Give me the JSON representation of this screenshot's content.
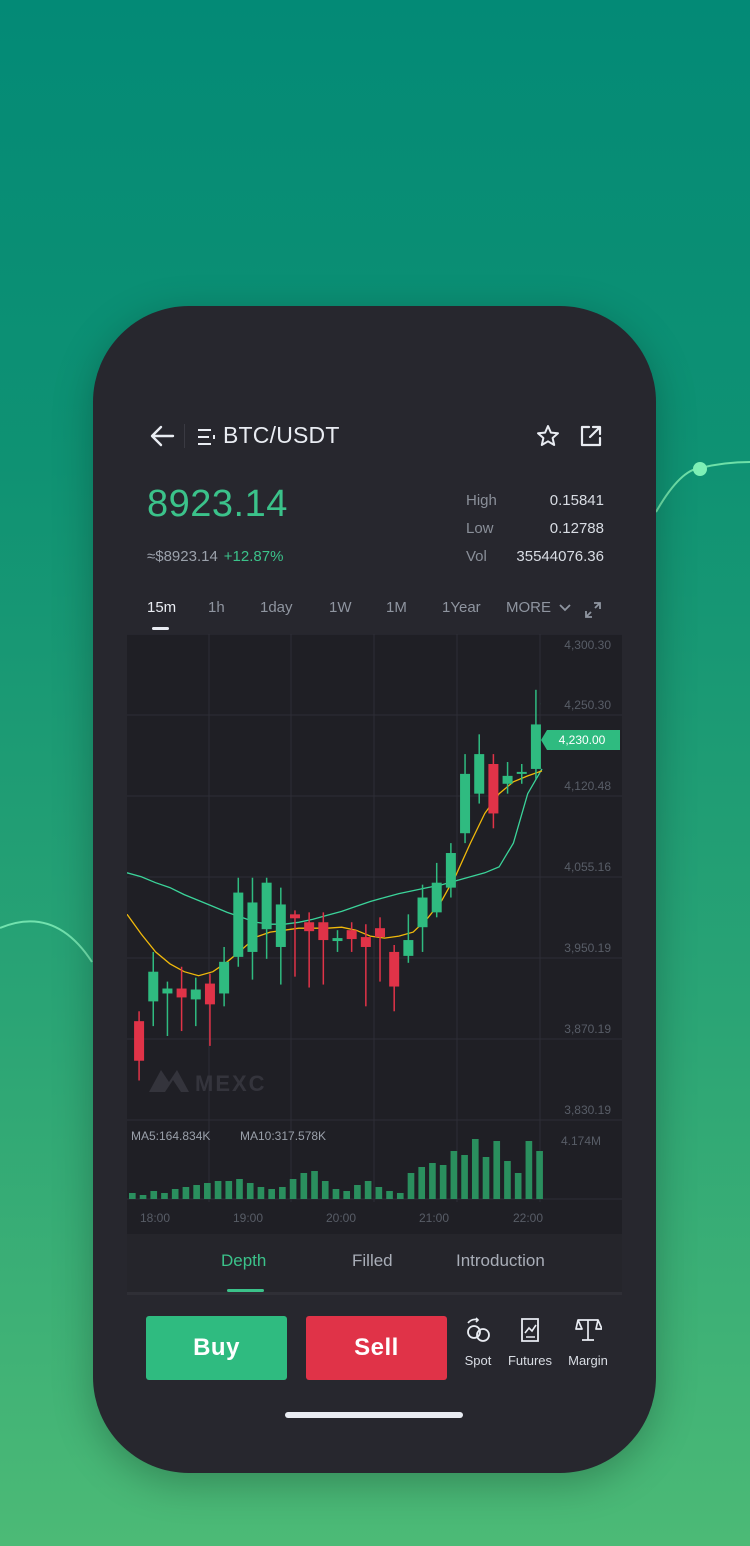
{
  "header": {
    "title": "BTC/USDT"
  },
  "ticker": {
    "price": "8923.14",
    "usd_value": "≈$8923.14",
    "change": "+12.87%",
    "stats": [
      {
        "label": "High",
        "value": "0.15841"
      },
      {
        "label": "Low",
        "value": "0.12788"
      },
      {
        "label": "Vol",
        "value": "35544076.36"
      }
    ]
  },
  "timeframes": [
    "15m",
    "1h",
    "1day",
    "1W",
    "1M",
    "1Year",
    "MORE"
  ],
  "indicators": {
    "ma5": "MA5:164.834K",
    "ma10": "MA10:317.578K"
  },
  "tabs": [
    "Depth",
    "Filled",
    "Introduction"
  ],
  "actions": {
    "buy": "Buy",
    "sell": "Sell",
    "modes": [
      "Spot",
      "Futures",
      "Margin"
    ]
  },
  "colors": {
    "up": "#2fbb80",
    "down": "#e03348",
    "ma_short": "#f0b90b",
    "ma_long": "#3bd49a"
  },
  "chart_data": {
    "type": "candlestick",
    "y_ticks": [
      "4,300.30",
      "4,250.30",
      "4,120.48",
      "4,055.16",
      "3,950.19",
      "3,870.19",
      "3,830.19"
    ],
    "current_price_label": "4,230.00",
    "volume_label": "4.174M",
    "x_ticks": [
      "18:00",
      "19:00",
      "20:00",
      "21:00",
      "22:00"
    ],
    "watermark": "MEXC",
    "candles": [
      {
        "o": 3920,
        "c": 3880,
        "h": 3930,
        "l": 3860
      },
      {
        "o": 3940,
        "c": 3970,
        "h": 3990,
        "l": 3915
      },
      {
        "o": 3948,
        "c": 3953,
        "h": 3960,
        "l": 3905
      },
      {
        "o": 3953,
        "c": 3944,
        "h": 3975,
        "l": 3910
      },
      {
        "o": 3942,
        "c": 3952,
        "h": 3964,
        "l": 3915
      },
      {
        "o": 3958,
        "c": 3937,
        "h": 3968,
        "l": 3895
      },
      {
        "o": 3948,
        "c": 3980,
        "h": 3995,
        "l": 3935
      },
      {
        "o": 3985,
        "c": 4050,
        "h": 4065,
        "l": 3975
      },
      {
        "o": 3990,
        "c": 4040,
        "h": 4065,
        "l": 3962
      },
      {
        "o": 4013,
        "c": 4060,
        "h": 4065,
        "l": 3983
      },
      {
        "o": 3995,
        "c": 4038,
        "h": 4055,
        "l": 3957
      },
      {
        "o": 4028,
        "c": 4024,
        "h": 4032,
        "l": 3965
      },
      {
        "o": 4020,
        "c": 4011,
        "h": 4030,
        "l": 3954
      },
      {
        "o": 4020,
        "c": 4002,
        "h": 4030,
        "l": 3957
      },
      {
        "o": 4001,
        "c": 4004,
        "h": 4012,
        "l": 3990
      },
      {
        "o": 4012,
        "c": 4003,
        "h": 4020,
        "l": 3990
      },
      {
        "o": 4005,
        "c": 3995,
        "h": 4018,
        "l": 3935
      },
      {
        "o": 4014,
        "c": 4005,
        "h": 4025,
        "l": 3960
      },
      {
        "o": 3990,
        "c": 3955,
        "h": 3997,
        "l": 3930
      },
      {
        "o": 3986,
        "c": 4002,
        "h": 4028,
        "l": 3979
      },
      {
        "o": 4015,
        "c": 4045,
        "h": 4058,
        "l": 3990
      },
      {
        "o": 4030,
        "c": 4060,
        "h": 4080,
        "l": 4025
      },
      {
        "o": 4055,
        "c": 4090,
        "h": 4100,
        "l": 4045
      },
      {
        "o": 4110,
        "c": 4170,
        "h": 4190,
        "l": 4100
      },
      {
        "o": 4150,
        "c": 4190,
        "h": 4210,
        "l": 4140
      },
      {
        "o": 4180,
        "c": 4130,
        "h": 4190,
        "l": 4115
      },
      {
        "o": 4160,
        "c": 4168,
        "h": 4182,
        "l": 4150
      },
      {
        "o": 4170,
        "c": 4172,
        "h": 4180,
        "l": 4160
      },
      {
        "o": 4175,
        "c": 4220,
        "h": 4255,
        "l": 4165
      }
    ],
    "ma_short": [
      4028,
      4008,
      3990,
      3978,
      3970,
      3966,
      3970,
      3980,
      3992,
      4005,
      4010,
      4012,
      4014,
      4014,
      4014,
      4015,
      4012,
      4006,
      4004,
      4006,
      4010,
      4024,
      4042,
      4068,
      4100,
      4130,
      4150,
      4162,
      4168,
      4173
    ],
    "ma_long": [
      4070,
      4066,
      4060,
      4055,
      4048,
      4042,
      4036,
      4030,
      4025,
      4020,
      4018,
      4018,
      4020,
      4023,
      4027,
      4031,
      4036,
      4041,
      4045,
      4049,
      4052,
      4055,
      4058,
      4062,
      4066,
      4070,
      4076,
      4100,
      4150,
      4175
    ],
    "volumes": [
      6,
      4,
      8,
      6,
      10,
      12,
      14,
      16,
      18,
      18,
      20,
      16,
      12,
      10,
      12,
      20,
      26,
      28,
      18,
      10,
      8,
      14,
      18,
      12,
      8,
      6,
      26,
      32,
      36,
      34,
      48,
      44,
      60,
      42,
      58,
      38,
      26,
      58,
      48
    ]
  }
}
